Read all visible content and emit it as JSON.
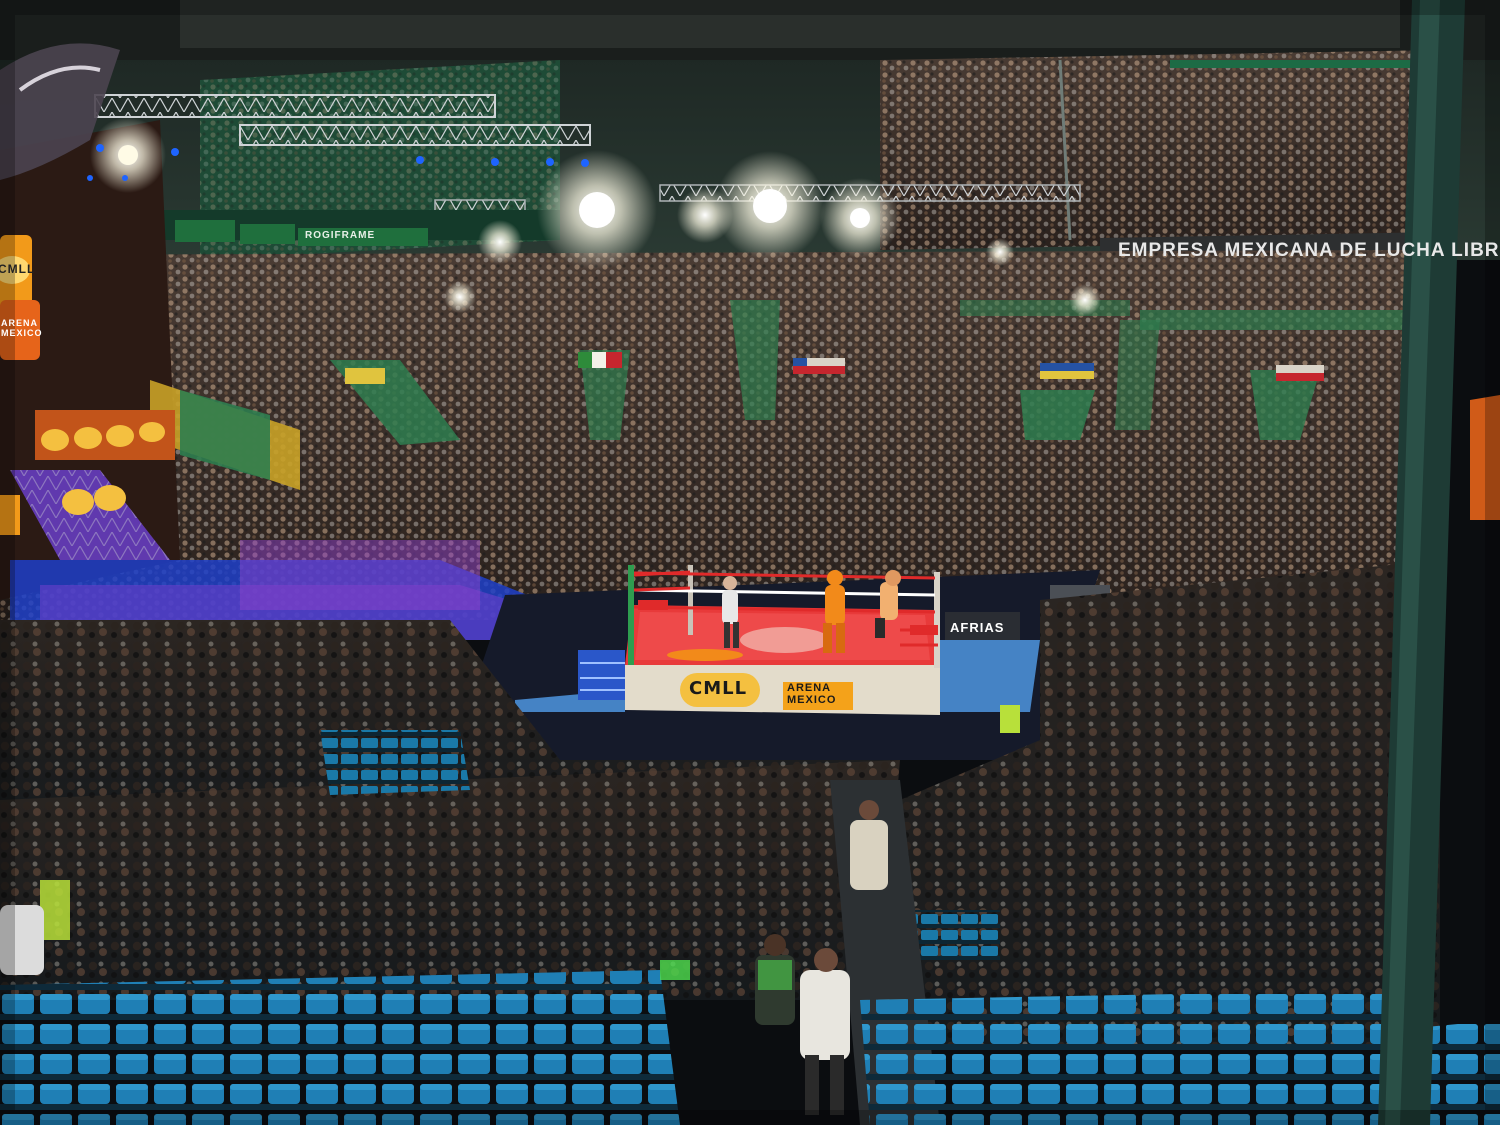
{
  "scene": {
    "banner": "EMPRESA MEXICANA DE LUCHA LIBRE",
    "logo_primary": "CMLL",
    "logo_secondary": "ARENA MEXICO",
    "apron_left": "CMLL",
    "apron_right": "ARENA MEXICO",
    "sponsor_ring": "AFRIAS",
    "sponsor_rail": "ROGIFRAME"
  },
  "colors": {
    "ring_mat": "#e83a3a",
    "ring_apron": "#d9d2c0",
    "floor_blue": "#4a8fd6",
    "seats_blue": "#1f7fb5",
    "arena_green": "#2e7d4f",
    "stage_purple": "#6a3fc9",
    "light_white": "#fffbe6"
  }
}
